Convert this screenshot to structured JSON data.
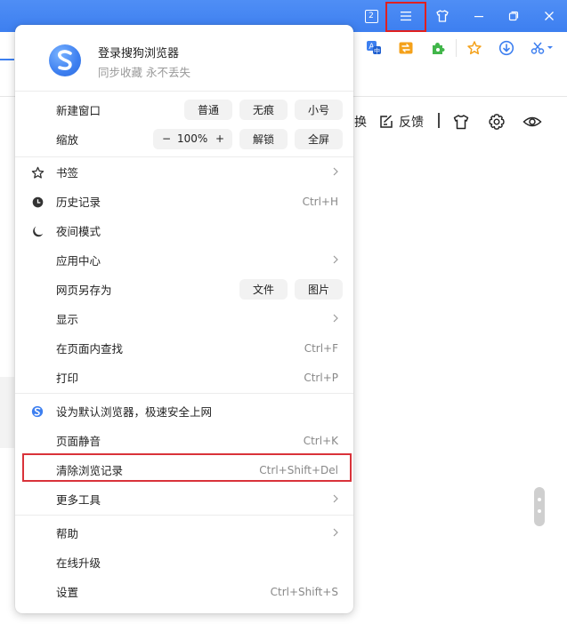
{
  "titlebar": {
    "tab_count": "2",
    "colors": {
      "bar": "#3d7ff0",
      "highlight": "#e02020"
    }
  },
  "page": {
    "partial_label": "换",
    "feedback_label": "反馈"
  },
  "menu": {
    "header": {
      "title": "登录搜狗浏览器",
      "subtitle": "同步收藏 永不丢失"
    },
    "new_window": {
      "label": "新建窗口",
      "options": [
        "普通",
        "无痕",
        "小号"
      ]
    },
    "zoom": {
      "label": "缩放",
      "minus": "−",
      "value": "100%",
      "plus": "+",
      "unlock": "解锁",
      "fullscreen": "全屏"
    },
    "bookmarks": {
      "label": "书签",
      "icon": "star-icon"
    },
    "history": {
      "label": "历史记录",
      "shortcut": "Ctrl+H",
      "icon": "clock-icon"
    },
    "night_mode": {
      "label": "夜间模式",
      "icon": "moon-icon"
    },
    "app_center": {
      "label": "应用中心"
    },
    "save_as": {
      "label": "网页另存为",
      "options": [
        "文件",
        "图片"
      ]
    },
    "display": {
      "label": "显示"
    },
    "find": {
      "label": "在页面内查找",
      "shortcut": "Ctrl+F"
    },
    "print": {
      "label": "打印",
      "shortcut": "Ctrl+P"
    },
    "default_browser": {
      "label": "设为默认浏览器，极速安全上网",
      "icon": "sogou-logo-icon"
    },
    "mute": {
      "label": "页面静音",
      "shortcut": "Ctrl+K"
    },
    "clear_history": {
      "label": "清除浏览记录",
      "shortcut": "Ctrl+Shift+Del"
    },
    "more_tools": {
      "label": "更多工具"
    },
    "help": {
      "label": "帮助"
    },
    "upgrade": {
      "label": "在线升级"
    },
    "settings": {
      "label": "设置",
      "shortcut": "Ctrl+Shift+S"
    }
  }
}
